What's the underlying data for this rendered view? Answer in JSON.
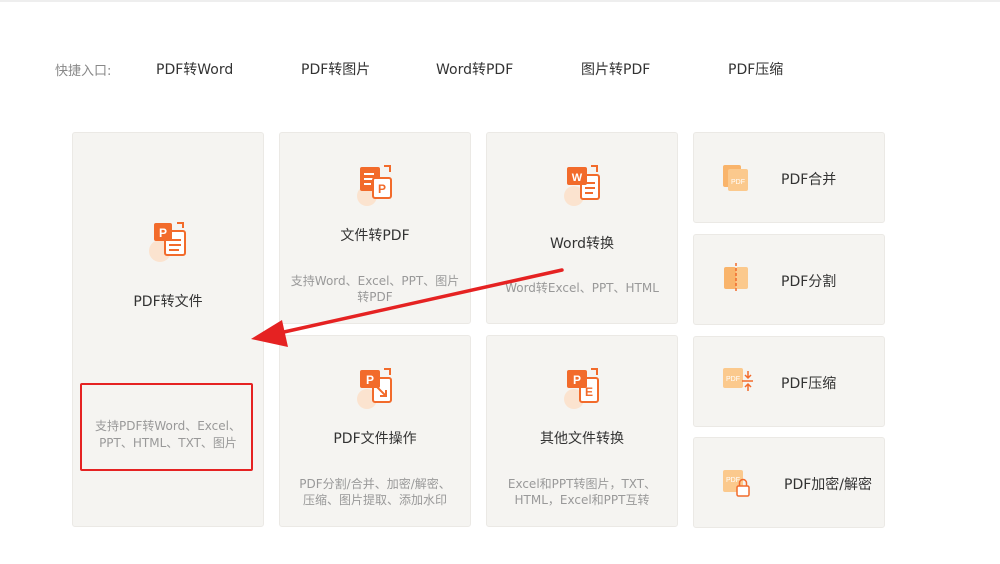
{
  "quick_entry": {
    "label": "快捷入口:",
    "links": [
      "PDF转Word",
      "PDF转图片",
      "Word转PDF",
      "图片转PDF",
      "PDF压缩"
    ]
  },
  "cards": {
    "pdf_to_file": {
      "title": "PDF转文件",
      "desc_line1": "支持PDF转Word、Excel、",
      "desc_line2": "PPT、HTML、TXT、图片",
      "icon": "pdf-convert-icon"
    },
    "file_to_pdf": {
      "title": "文件转PDF",
      "desc_line1": "支持Word、Excel、PPT、图片",
      "desc_line2": "转PDF",
      "icon": "file-to-pdf-icon"
    },
    "word_convert": {
      "title": "Word转换",
      "desc": "Word转Excel、PPT、HTML",
      "icon": "word-convert-icon"
    },
    "pdf_operation": {
      "title": "PDF文件操作",
      "desc_line1": "PDF分割/合并、加密/解密、",
      "desc_line2": "压缩、图片提取、添加水印",
      "icon": "pdf-operation-icon"
    },
    "other_convert": {
      "title": "其他文件转换",
      "desc_line1": "Excel和PPT转图片，TXT、",
      "desc_line2": "HTML，Excel和PPT互转",
      "icon": "other-convert-icon"
    }
  },
  "side_tools": [
    {
      "title": "PDF合并",
      "icon": "pdf-merge-icon"
    },
    {
      "title": "PDF分割",
      "icon": "pdf-split-icon"
    },
    {
      "title": "PDF压缩",
      "icon": "pdf-compress-icon"
    },
    {
      "title": "PDF加密/解密",
      "icon": "pdf-lock-icon"
    }
  ],
  "colors": {
    "accent": "#f26b2b",
    "accent_light": "#f9b46b",
    "card_bg": "#f5f4f1",
    "annotation_red": "#e52222"
  }
}
